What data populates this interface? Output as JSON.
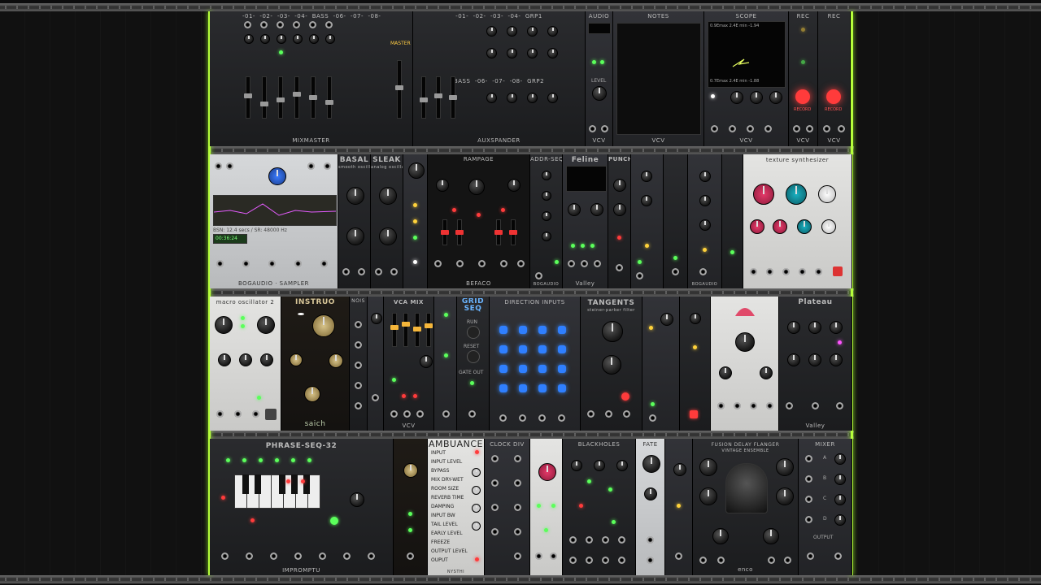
{
  "rows": [
    {
      "labels": {
        "mixmaster": "MIXMASTER",
        "mixmaster_buses": [
          "-01-",
          "-02-",
          "-03-",
          "-04-",
          "BASS",
          "-06-",
          "-07-",
          "-08-"
        ],
        "mixmaster_group": "MASTER",
        "aux": "AUXSPANDER",
        "aux_buses": [
          "-01-",
          "-02-",
          "-03-",
          "-04-",
          "GRP1"
        ],
        "aux_buses2": [
          "BASS",
          "-06-",
          "-07-",
          "-08-",
          "GRP2"
        ],
        "audio": "AUDIO",
        "audio_level": "LEVEL",
        "audio_brand": "VCV",
        "notes": "NOTES",
        "notes_brand": "VCV",
        "scope": "SCOPE",
        "scope_brand": "VCV",
        "scope_readout_top": "0.9Emax   2.4E min -1.94",
        "scope_readout_bot": "0.7Emax   2.4E min -1.88",
        "rec1": "REC",
        "rec2": "REC",
        "rec_brand": "VCV",
        "record": "RECORD"
      }
    },
    {
      "labels": {
        "seq": "BOGAUDIO · SAMPLER",
        "seq_readout": "BSN: 12.4 secs / SR: 48000 Hz",
        "seq_time": "00:36:24",
        "basal": "BASAL",
        "basal_sub": "smooth oscillator",
        "sleak": "SLEAK",
        "sleak_sub": "analog oscillator",
        "rampage": "RAMPAGE",
        "befaco": "BEFACO",
        "adrseq": "ADDR-SEQ",
        "feline": "Feline",
        "feline_brand": "Valley",
        "punch": "PUNCH",
        "bogaudio": "BOGAUDIO",
        "texture": "texture synthesizer"
      }
    },
    {
      "labels": {
        "macro": "macro oscillator 2",
        "instruo": "INSTRUO",
        "instruo_brand": "saich",
        "noise": "NOIS",
        "vcamix": "VCA MIX",
        "vcamix_brand": "VCV",
        "gridseq": "GRID SEQ",
        "direction": "DIRECTION INPUTS",
        "gridseq_labels": [
          "RUN",
          "RESET",
          "GATE OUT"
        ],
        "tangents": "TANGENTS",
        "tangents_sub": "steiner-parker filter",
        "plateau": "Plateau",
        "plateau_brand": "Valley"
      }
    },
    {
      "labels": {
        "phrase": "PHRASE-SEQ-32",
        "phrase_brand": "IMPROMPTU",
        "ambuance": "AMBUANCE",
        "ambuance_params": [
          "INPUT",
          "INPUT LEVEL",
          "BYPASS",
          "MIX DRY-WET",
          "ROOM SIZE",
          "REVERB TIME",
          "DAMPING",
          "INPUT BW",
          "TAIL LEVEL",
          "EARLY LEVEL",
          "FREEZE",
          "OUTPUT LEVEL",
          "OUPUT"
        ],
        "ambuance_brand": "NYSTHI",
        "clockdiv": "CLOCK DIV",
        "blackholes": "BLACKHOLES",
        "fate": "FATE",
        "fusion": "FUSION DELAY FLANGER",
        "fusion_sub": "VINTAGE ENSEMBLE",
        "fusion_brand": "enco",
        "mixer": "MIXER",
        "mixer_inputs": [
          "A",
          "B",
          "C",
          "D"
        ],
        "mixer_output": "OUTPUT"
      }
    }
  ]
}
